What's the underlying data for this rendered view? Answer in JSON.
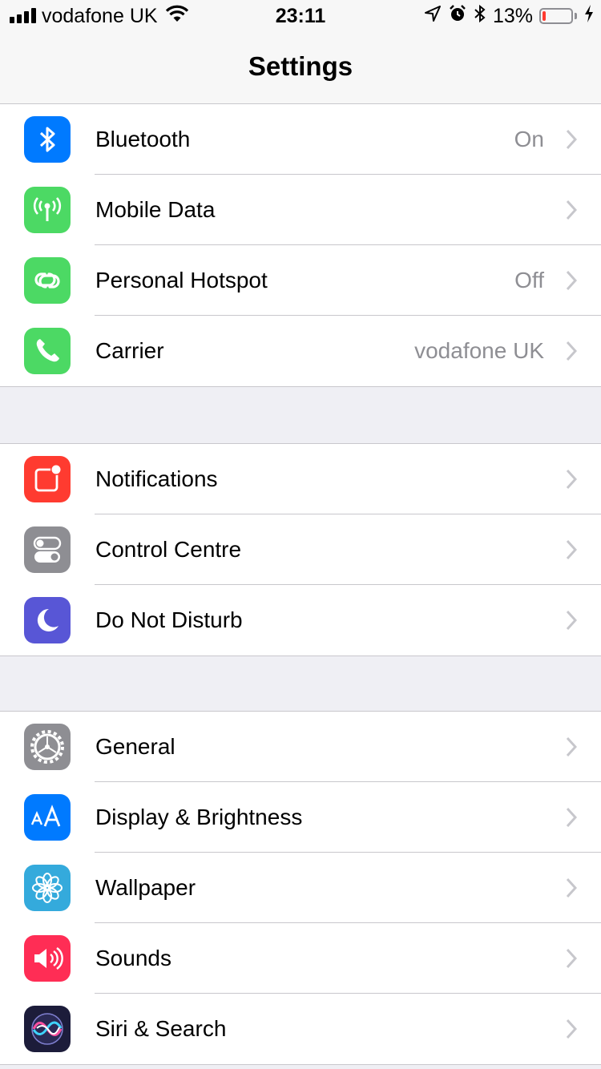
{
  "status_bar": {
    "carrier": "vodafone UK",
    "time": "23:11",
    "battery_percent_label": "13%",
    "battery_level": 0.13,
    "battery_color": "#ff3b30",
    "icons": [
      "signal-icon",
      "wifi-icon",
      "location-arrow-icon",
      "alarm-icon",
      "bluetooth-icon",
      "battery-icon",
      "charging-bolt-icon"
    ]
  },
  "nav": {
    "title": "Settings"
  },
  "groups": [
    {
      "rows": [
        {
          "label": "Bluetooth",
          "value": "On",
          "icon": "bluetooth-icon",
          "color": "#007aff"
        },
        {
          "label": "Mobile Data",
          "value": "",
          "icon": "antenna-icon",
          "color": "#4cd964"
        },
        {
          "label": "Personal Hotspot",
          "value": "Off",
          "icon": "hotspot-icon",
          "color": "#4cd964"
        },
        {
          "label": "Carrier",
          "value": "vodafone UK",
          "icon": "phone-icon",
          "color": "#4cd964"
        }
      ]
    },
    {
      "rows": [
        {
          "label": "Notifications",
          "value": "",
          "icon": "notifications-icon",
          "color": "#ff3b30"
        },
        {
          "label": "Control Centre",
          "value": "",
          "icon": "toggles-icon",
          "color": "#8e8e93"
        },
        {
          "label": "Do Not Disturb",
          "value": "",
          "icon": "moon-icon",
          "color": "#5856d6"
        }
      ]
    },
    {
      "rows": [
        {
          "label": "General",
          "value": "",
          "icon": "gear-icon",
          "color": "#8e8e93"
        },
        {
          "label": "Display & Brightness",
          "value": "",
          "icon": "text-size-icon",
          "color": "#007aff"
        },
        {
          "label": "Wallpaper",
          "value": "",
          "icon": "flower-icon",
          "color": "#34aadc"
        },
        {
          "label": "Sounds",
          "value": "",
          "icon": "speaker-icon",
          "color": "#ff2d55"
        },
        {
          "label": "Siri & Search",
          "value": "",
          "icon": "siri-icon",
          "color": "#1c1c3a"
        }
      ]
    }
  ]
}
